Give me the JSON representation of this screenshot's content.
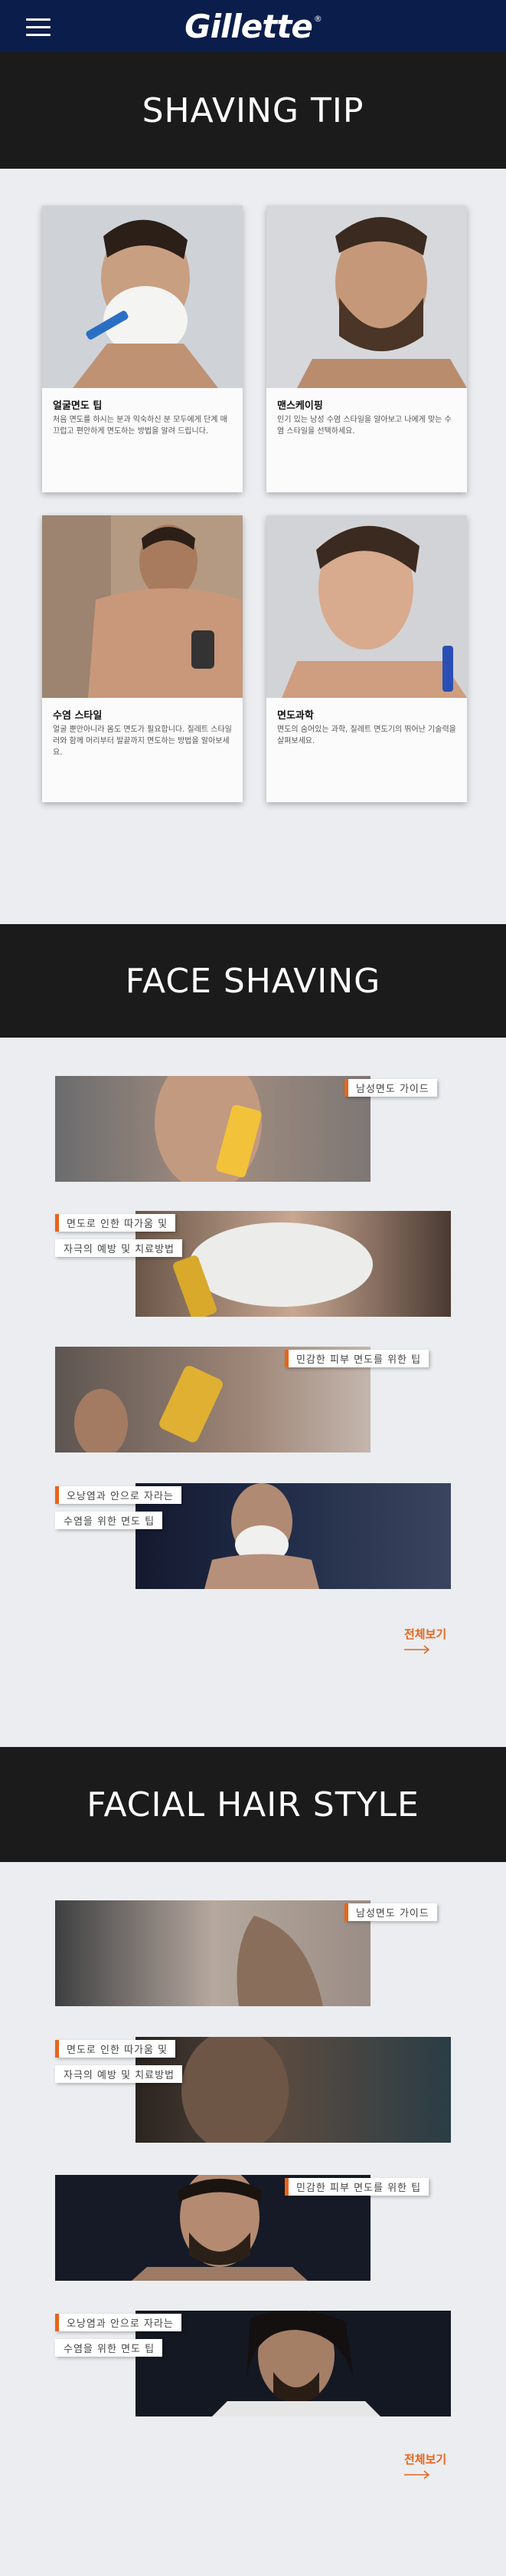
{
  "header": {
    "logo": "Gillette",
    "logo_mark": "®",
    "menu_icon": "hamburger-icon"
  },
  "sections": {
    "shaving_tip": {
      "title": "SHAVING TIP",
      "cards": [
        {
          "title": "얼굴면도 팁",
          "desc": "처음 면도를 하시는 분과 익숙하신 분 모두에게 단계 매끄럽고 편안하게 면도하는 방법을 알려 드립니다."
        },
        {
          "title": "맨스케이핑",
          "desc": "인기 있는 남성 수염 스타일을 알아보고 나에게 맞는 수염 스타일을 선택하세요."
        },
        {
          "title": "수염 스타일",
          "desc": "얼굴 뿐만아니라 몸도 면도가 필요합니다. 질레트 스타일러와 함께 머리부터 발끝까지 면도하는 방법을 알아보세요."
        },
        {
          "title": "면도과학",
          "desc": "면도의 숨어있는 과학, 질레트 면도기의 뛰어난 기술력을 살펴보세요."
        }
      ]
    },
    "face_shaving": {
      "title": "FACE SHAVING",
      "articles": [
        {
          "labels": [
            "남성면도 가이드"
          ]
        },
        {
          "labels": [
            "면도로 인한 따가움 및",
            "자극의 예방 및 치료방법"
          ]
        },
        {
          "labels": [
            "민감한 피부 면도를 위한 팁"
          ]
        },
        {
          "labels": [
            "오낭염과 안으로 자라는",
            "수염을 위한 면도 팁"
          ]
        }
      ],
      "more": "전체보기"
    },
    "facial_hair": {
      "title": "FACIAL HAIR STYLE",
      "articles": [
        {
          "labels": [
            "남성면도 가이드"
          ]
        },
        {
          "labels": [
            "면도로 인한 따가움 및",
            "자극의 예방 및 치료방법"
          ]
        },
        {
          "labels": [
            "민감한 피부 면도를 위한 팁"
          ]
        },
        {
          "labels": [
            "오낭염과 안으로 자라는",
            "수염을 위한 면도 팁"
          ]
        }
      ],
      "more": "전체보기"
    }
  },
  "colors": {
    "topbar": "#0b1d4a",
    "banner": "#1b1b1b",
    "accent": "#e8651a",
    "page_bg": "#ebedf0"
  }
}
